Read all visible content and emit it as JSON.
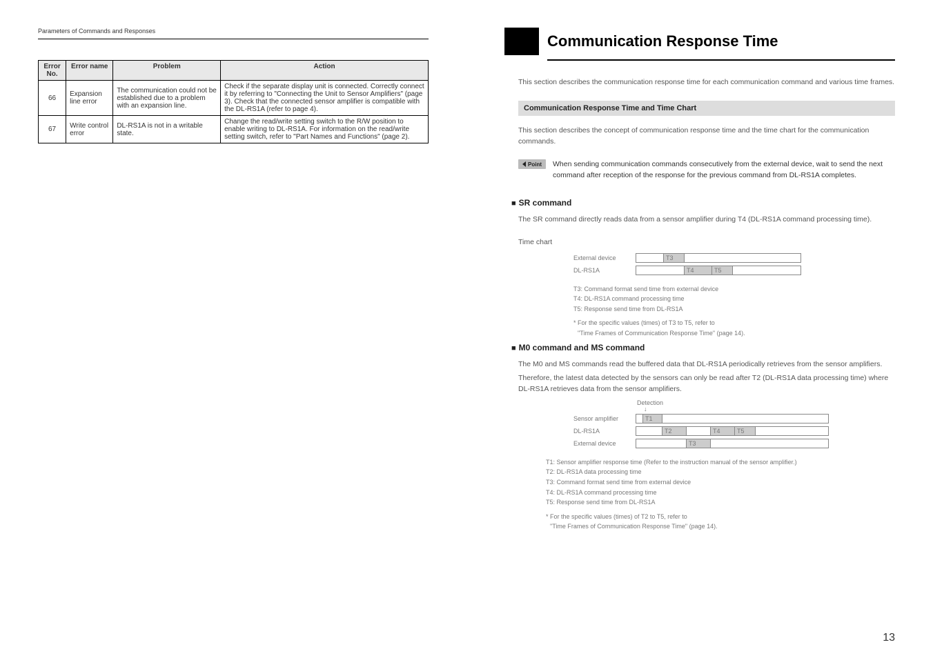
{
  "left": {
    "header": "Parameters of Commands and Responses",
    "table": {
      "headers": [
        "Error No.",
        "Error name",
        "Problem",
        "Action"
      ],
      "rows": [
        {
          "no": "66",
          "name": "Expansion line error",
          "problem": "The communication could not be established due to a problem with an expansion line.",
          "action": "Check if the separate display unit is connected. Correctly connect it by referring to \"Connecting the Unit to Sensor Amplifiers\" (page 3). Check that the connected sensor amplifier is compatible with the DL-RS1A (refer to page 4)."
        },
        {
          "no": "67",
          "name": "Write control error",
          "problem": "DL-RS1A is not in a writable state.",
          "action": "Change the read/write setting switch to the R/W position to enable writing to DL-RS1A. For information on the read/write setting switch, refer to \"Part Names and Functions\" (page 2)."
        }
      ]
    }
  },
  "right": {
    "title": "Communication Response Time",
    "intro": "This section describes the communication response time for each communication command and various time frames.",
    "section1_title": "Communication Response Time and Time Chart",
    "section1_text": "This section describes the concept of communication response time and the time chart for the communication commands.",
    "point_label": "Point",
    "point_text": "When sending communication commands consecutively from the external device, wait to send the next command after reception of the response for the previous command from DL-RS1A completes.",
    "sr": {
      "heading": "SR command",
      "text": "The SR command directly reads data from a sensor amplifier during T4 (DL-RS1A command processing time).",
      "chart_label": "Time chart",
      "row1_label": "External device",
      "row2_label": "DL-RS1A",
      "t3": "T3",
      "t4": "T4",
      "t5": "T5",
      "notes": [
        "T3: Command format send time from external device",
        "T4: DL-RS1A command processing time",
        "T5: Response send time from DL-RS1A"
      ],
      "footnote1": "* For the specific values (times) of T3 to T5, refer to",
      "footnote2": "\"Time Frames of Communication Response Time\" (page 14)."
    },
    "m0": {
      "heading": "M0 command and MS command",
      "text1": "The M0 and MS commands read the buffered data that DL-RS1A periodically retrieves from the sensor amplifiers.",
      "text2": "Therefore, the latest data detected by the sensors can only be read after T2 (DL-RS1A data processing time) where DL-RS1A retrieves data from the sensor amplifiers.",
      "detection": "Detection",
      "row1_label": "Sensor amplifier",
      "row2_label": "DL-RS1A",
      "row3_label": "External device",
      "t1": "T1",
      "t2": "T2",
      "t3": "T3",
      "t4": "T4",
      "t5": "T5",
      "notes": [
        "T1: Sensor amplifier response time (Refer to the instruction manual of the sensor amplifier.)",
        "T2: DL-RS1A data processing time",
        "T3: Command format send time from external device",
        "T4: DL-RS1A command processing time",
        "T5: Response send time from DL-RS1A"
      ],
      "footnote1": "* For the specific values (times) of T2 to T5, refer to",
      "footnote2": "\"Time Frames of Communication Response Time\" (page 14)."
    },
    "page_num": "13"
  }
}
